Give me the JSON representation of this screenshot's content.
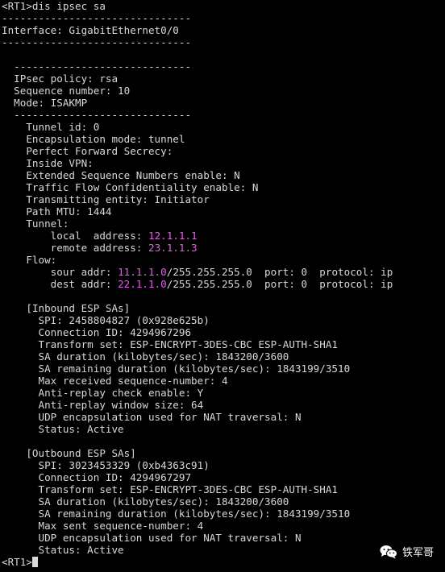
{
  "terminal": {
    "lines": [
      {
        "text": "<RT1>dis ipsec sa"
      },
      {
        "text": "-------------------------------"
      },
      {
        "text": "Interface: GigabitEthernet0/0"
      },
      {
        "text": "-------------------------------"
      },
      {
        "text": ""
      },
      {
        "text": "  -----------------------------"
      },
      {
        "text": "  IPsec policy: rsa"
      },
      {
        "text": "  Sequence number: 10"
      },
      {
        "text": "  Mode: ISAKMP"
      },
      {
        "text": "  -----------------------------"
      },
      {
        "text": "    Tunnel id: 0"
      },
      {
        "text": "    Encapsulation mode: tunnel"
      },
      {
        "text": "    Perfect Forward Secrecy:"
      },
      {
        "text": "    Inside VPN:"
      },
      {
        "text": "    Extended Sequence Numbers enable: N"
      },
      {
        "text": "    Traffic Flow Confidentiality enable: N"
      },
      {
        "text": "    Transmitting entity: Initiator"
      },
      {
        "text": "    Path MTU: 1444"
      },
      {
        "text": "    Tunnel:"
      },
      {
        "text": "        local  address: ",
        "hl": "12.1.1.1",
        "rest": ""
      },
      {
        "text": "        remote address: ",
        "hl": "23.1.1.3",
        "rest": ""
      },
      {
        "text": "    Flow:"
      },
      {
        "text": "        sour addr: ",
        "hl": "11.1.1.0",
        "rest": "/255.255.255.0  port: 0  protocol: ip"
      },
      {
        "text": "        dest addr: ",
        "hl": "22.1.1.0",
        "rest": "/255.255.255.0  port: 0  protocol: ip"
      },
      {
        "text": ""
      },
      {
        "text": "    [Inbound ESP SAs]"
      },
      {
        "text": "      SPI: 2458804827 (0x928e625b)"
      },
      {
        "text": "      Connection ID: 4294967296"
      },
      {
        "text": "      Transform set: ESP-ENCRYPT-3DES-CBC ESP-AUTH-SHA1"
      },
      {
        "text": "      SA duration (kilobytes/sec): 1843200/3600"
      },
      {
        "text": "      SA remaining duration (kilobytes/sec): 1843199/3510"
      },
      {
        "text": "      Max received sequence-number: 4"
      },
      {
        "text": "      Anti-replay check enable: Y"
      },
      {
        "text": "      Anti-replay window size: 64"
      },
      {
        "text": "      UDP encapsulation used for NAT traversal: N"
      },
      {
        "text": "      Status: Active"
      },
      {
        "text": ""
      },
      {
        "text": "    [Outbound ESP SAs]"
      },
      {
        "text": "      SPI: 3023453329 (0xb4363c91)"
      },
      {
        "text": "      Connection ID: 4294967297"
      },
      {
        "text": "      Transform set: ESP-ENCRYPT-3DES-CBC ESP-AUTH-SHA1"
      },
      {
        "text": "      SA duration (kilobytes/sec): 1843200/3600"
      },
      {
        "text": "      SA remaining duration (kilobytes/sec): 1843199/3510"
      },
      {
        "text": "      Max sent sequence-number: 4"
      },
      {
        "text": "      UDP encapsulation used for NAT traversal: N"
      },
      {
        "text": "      Status: Active"
      },
      {
        "text": "<RT1>",
        "cursor": true
      }
    ]
  },
  "watermark": {
    "text": "铁军哥",
    "icon": "wechat-icon"
  },
  "colors": {
    "background": "#000000",
    "text": "#d8d8d8",
    "highlight": "#e060e0"
  }
}
